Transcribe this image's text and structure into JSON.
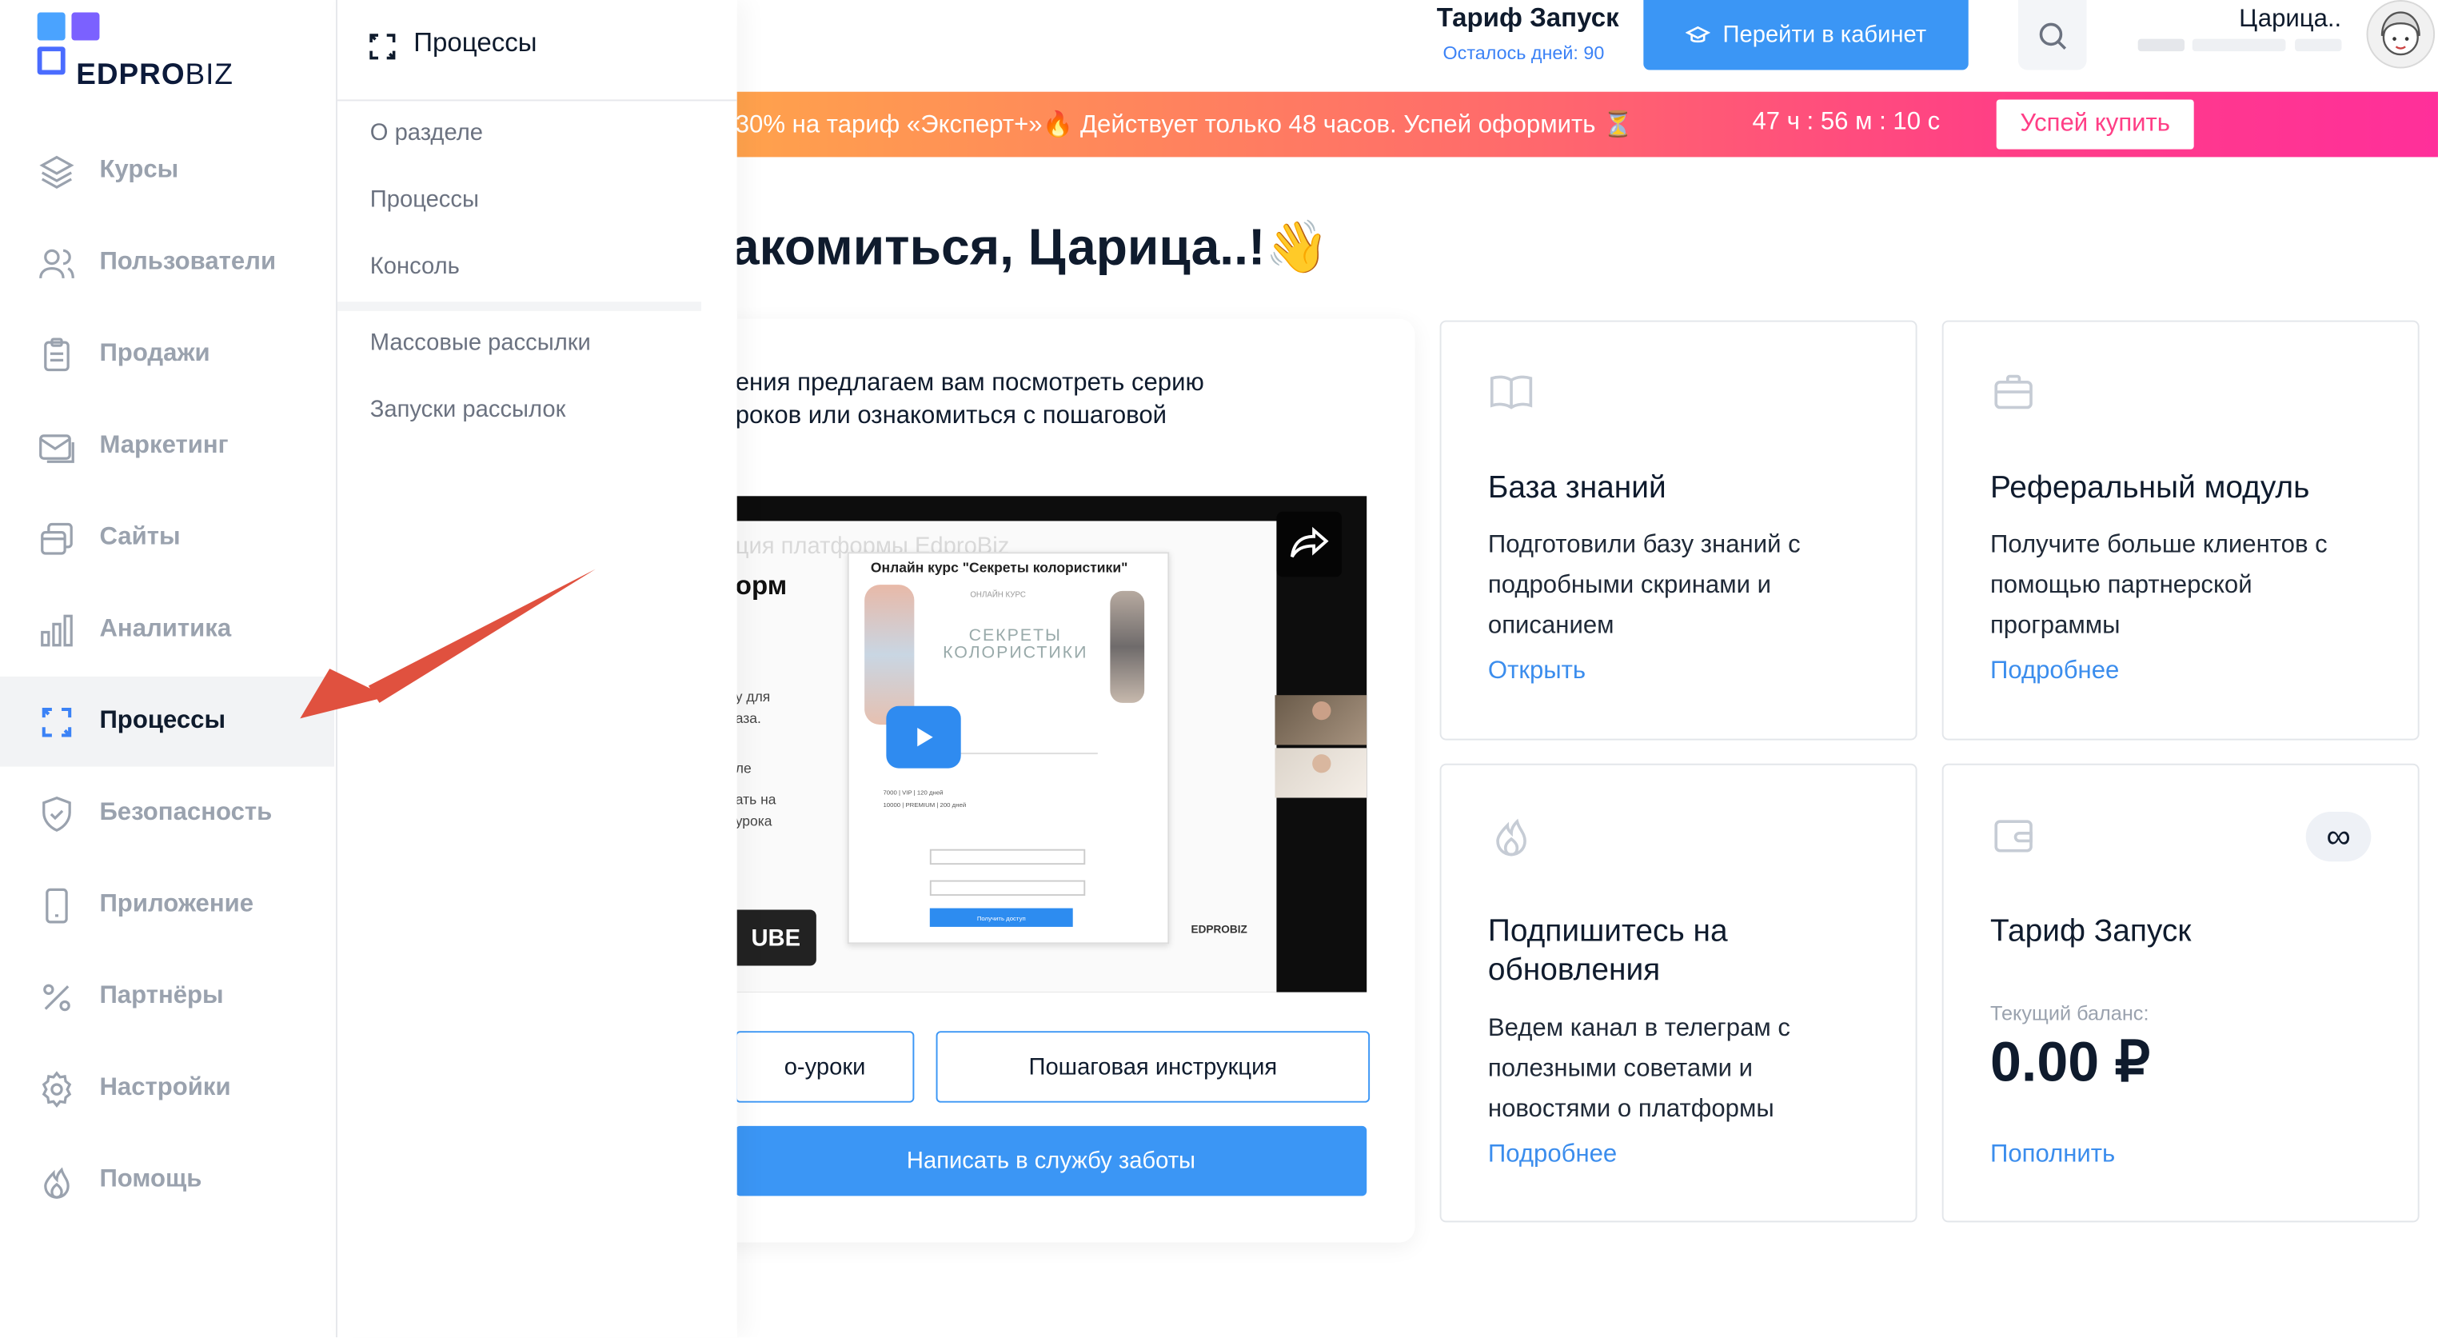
{
  "sidebar": {
    "logo": {
      "left": "EDPRO",
      "right": "BIZ",
      "colors": [
        "#4aa3ff",
        "#7b61ff",
        "#4aa3ff"
      ]
    },
    "items": [
      {
        "label": "Курсы",
        "icon": "layers-icon",
        "active": false
      },
      {
        "label": "Пользователи",
        "icon": "users-icon",
        "active": false
      },
      {
        "label": "Продажи",
        "icon": "clipboard-icon",
        "active": false
      },
      {
        "label": "Маркетинг",
        "icon": "mail-icon",
        "active": false
      },
      {
        "label": "Сайты",
        "icon": "windows-icon",
        "active": false
      },
      {
        "label": "Аналитика",
        "icon": "bar-chart-icon",
        "active": false
      },
      {
        "label": "Процессы",
        "icon": "processes-icon",
        "active": true
      },
      {
        "label": "Безопасность",
        "icon": "shield-icon",
        "active": false
      },
      {
        "label": "Приложение",
        "icon": "phone-icon",
        "active": false
      },
      {
        "label": "Партнёры",
        "icon": "percent-icon",
        "active": false
      },
      {
        "label": "Настройки",
        "icon": "gear-icon",
        "active": false
      },
      {
        "label": "Помощь",
        "icon": "flame-icon",
        "active": false
      }
    ]
  },
  "submenu": {
    "title": "Процессы",
    "items": [
      "О разделе",
      "Процессы",
      "Консоль",
      "Массовые рассылки",
      "Запуски рассылок"
    ]
  },
  "header": {
    "tariff_name": "Тариф Запуск",
    "tariff_days": "Осталось дней: 90",
    "cabinet_button": "Перейти в кабинет",
    "user_name": "Царица.."
  },
  "promo": {
    "text": "30% на тариф «Эксперт+»🔥 Действует только 48 часов. Успей оформить ⏳",
    "timer": "47 ч : 56 м : 10 с",
    "button": "Успей купить"
  },
  "greeting": "акомиться, Царица..!👋",
  "welcome": {
    "text_line1": "ения предлагаем вам посмотреть серию",
    "text_line2": "роков или ознакомиться с пошаговой",
    "video": {
      "title": "ция платформы EdproBiz",
      "side_text": "орм",
      "course_label": "Онлайн курс \"Секреты колористики\"",
      "course_small": "ОНЛАЙН КУРС",
      "course_heading": "СЕКРЕТЫ КОЛОРИСТИКИ",
      "left_snips": [
        "у для",
        "аза.",
        "ле",
        "ать на",
        "урока"
      ],
      "form_button": "Получить доступ",
      "watermark": "EDPROBIZ",
      "yt_badge": "UBE",
      "price_rows": [
        "7000 | VIP | 120 дней",
        "10000 | PREMIUM | 200 дней"
      ]
    },
    "btn_video": "о-уроки",
    "btn_instruction": "Пошаговая инструкция",
    "btn_support": "Написать в службу заботы"
  },
  "cards": [
    {
      "icon": "book-icon",
      "title": "База знаний",
      "desc": "Подготовили базу знаний с подробными скринами и описанием",
      "link": "Открыть"
    },
    {
      "icon": "briefcase-icon",
      "title": "Реферальный модуль",
      "desc": "Получите больше клиентов с помощью партнерской программы",
      "link": "Подробнее"
    },
    {
      "icon": "flame-icon",
      "title": "Подпишитесь на обновления",
      "desc": "Ведем канал в телеграм с полезными советами и новостями о платформы",
      "link": "Подробнее"
    },
    {
      "icon": "wallet-icon",
      "title": "Тариф Запуск",
      "balance_label": "Текущий баланс:",
      "balance": "0.00 ₽",
      "badge": "∞",
      "link": "Пополнить"
    }
  ]
}
